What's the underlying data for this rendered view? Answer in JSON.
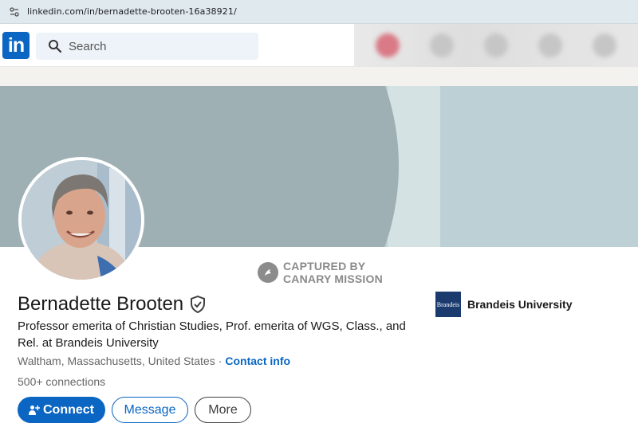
{
  "browser": {
    "url": "linkedin.com/in/bernadette-brooten-16a38921/"
  },
  "nav": {
    "logo_text": "in",
    "search_placeholder": "Search"
  },
  "watermark": {
    "line1": "CAPTURED BY",
    "line2": "CANARY MISSION"
  },
  "profile": {
    "name": "Bernadette Brooten",
    "headline": "Professor emerita of Christian Studies, Prof. emerita of WGS, Class., and Rel. at Brandeis University",
    "location": "Waltham, Massachusetts, United States",
    "separator": "·",
    "contact_label": "Contact info",
    "connections": "500+ connections"
  },
  "actions": {
    "connect_label": "Connect",
    "message_label": "Message",
    "more_label": "More"
  },
  "education": {
    "logo_text": "Brandeis",
    "name": "Brandeis University"
  },
  "colors": {
    "brand": "#0a66c2",
    "banner": "#bcd0d6",
    "banner_arc": "#9eb0b4"
  }
}
